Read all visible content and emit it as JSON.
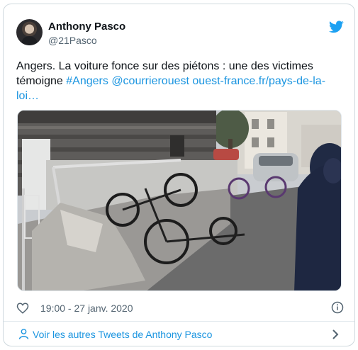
{
  "tweet": {
    "author": {
      "name": "Anthony Pasco",
      "handle": "@21Pasco"
    },
    "text": {
      "plain": "Angers. La voiture fonce sur des piétons : une des victimes témoigne ",
      "hashtag": "#Angers",
      "mention": "@courrierouest",
      "url": "ouest-france.fr/pays-de-la-loi…"
    },
    "timestamp": "19:00 - 27 janv. 2020",
    "colors": {
      "link": "#1b95e0",
      "brand": "#1da1f2",
      "text": "#0f1419",
      "muted": "#536471"
    },
    "icons": [
      "twitter-bird-icon",
      "heart-icon",
      "info-icon",
      "user-icon",
      "chevron-right-icon"
    ]
  },
  "footer": {
    "label": "Voir les autres Tweets de Anthony Pasco"
  }
}
